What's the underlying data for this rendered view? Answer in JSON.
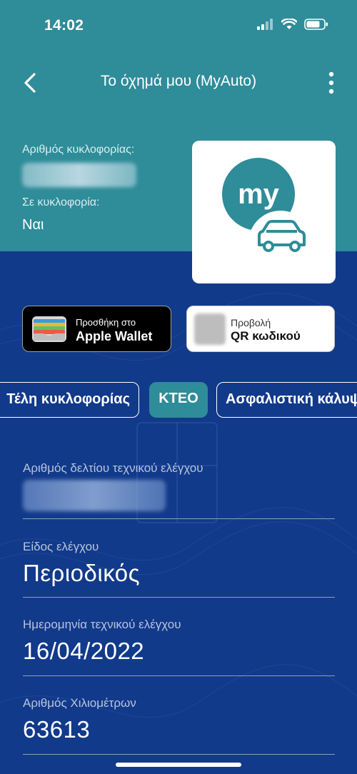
{
  "status": {
    "time": "14:02"
  },
  "nav": {
    "title": "Το όχημά μου (MyAuto)"
  },
  "vehicle": {
    "registration_label": "Αριθμός κυκλοφορίας:",
    "in_circulation_label": "Σε κυκλοφορία:",
    "in_circulation_value": "Ναι"
  },
  "logo": {
    "text": "my"
  },
  "wallet_button": {
    "small": "Προσθήκη στο",
    "big": "Apple Wallet"
  },
  "qr_button": {
    "small": "Προβολή",
    "big": "QR κωδικού"
  },
  "tabs": [
    {
      "label": "Τέλη κυκλοφορίας"
    },
    {
      "label": "ΚΤΕΟ"
    },
    {
      "label": "Ασφαλιστική κάλυψη"
    }
  ],
  "fields": {
    "certificate_label": "Αριθμός δελτίου τεχνικού ελέγχου",
    "check_type_label": "Είδος ελέγχου",
    "check_type_value": "Περιοδικός",
    "check_date_label": "Ημερομηνία τεχνικού ελέγχου",
    "check_date_value": "16/04/2022",
    "km_label": "Αριθμός Χιλιομέτρων",
    "km_value": "63613"
  },
  "colors": {
    "teal": "#2f8c99",
    "navy": "#123a8a"
  }
}
